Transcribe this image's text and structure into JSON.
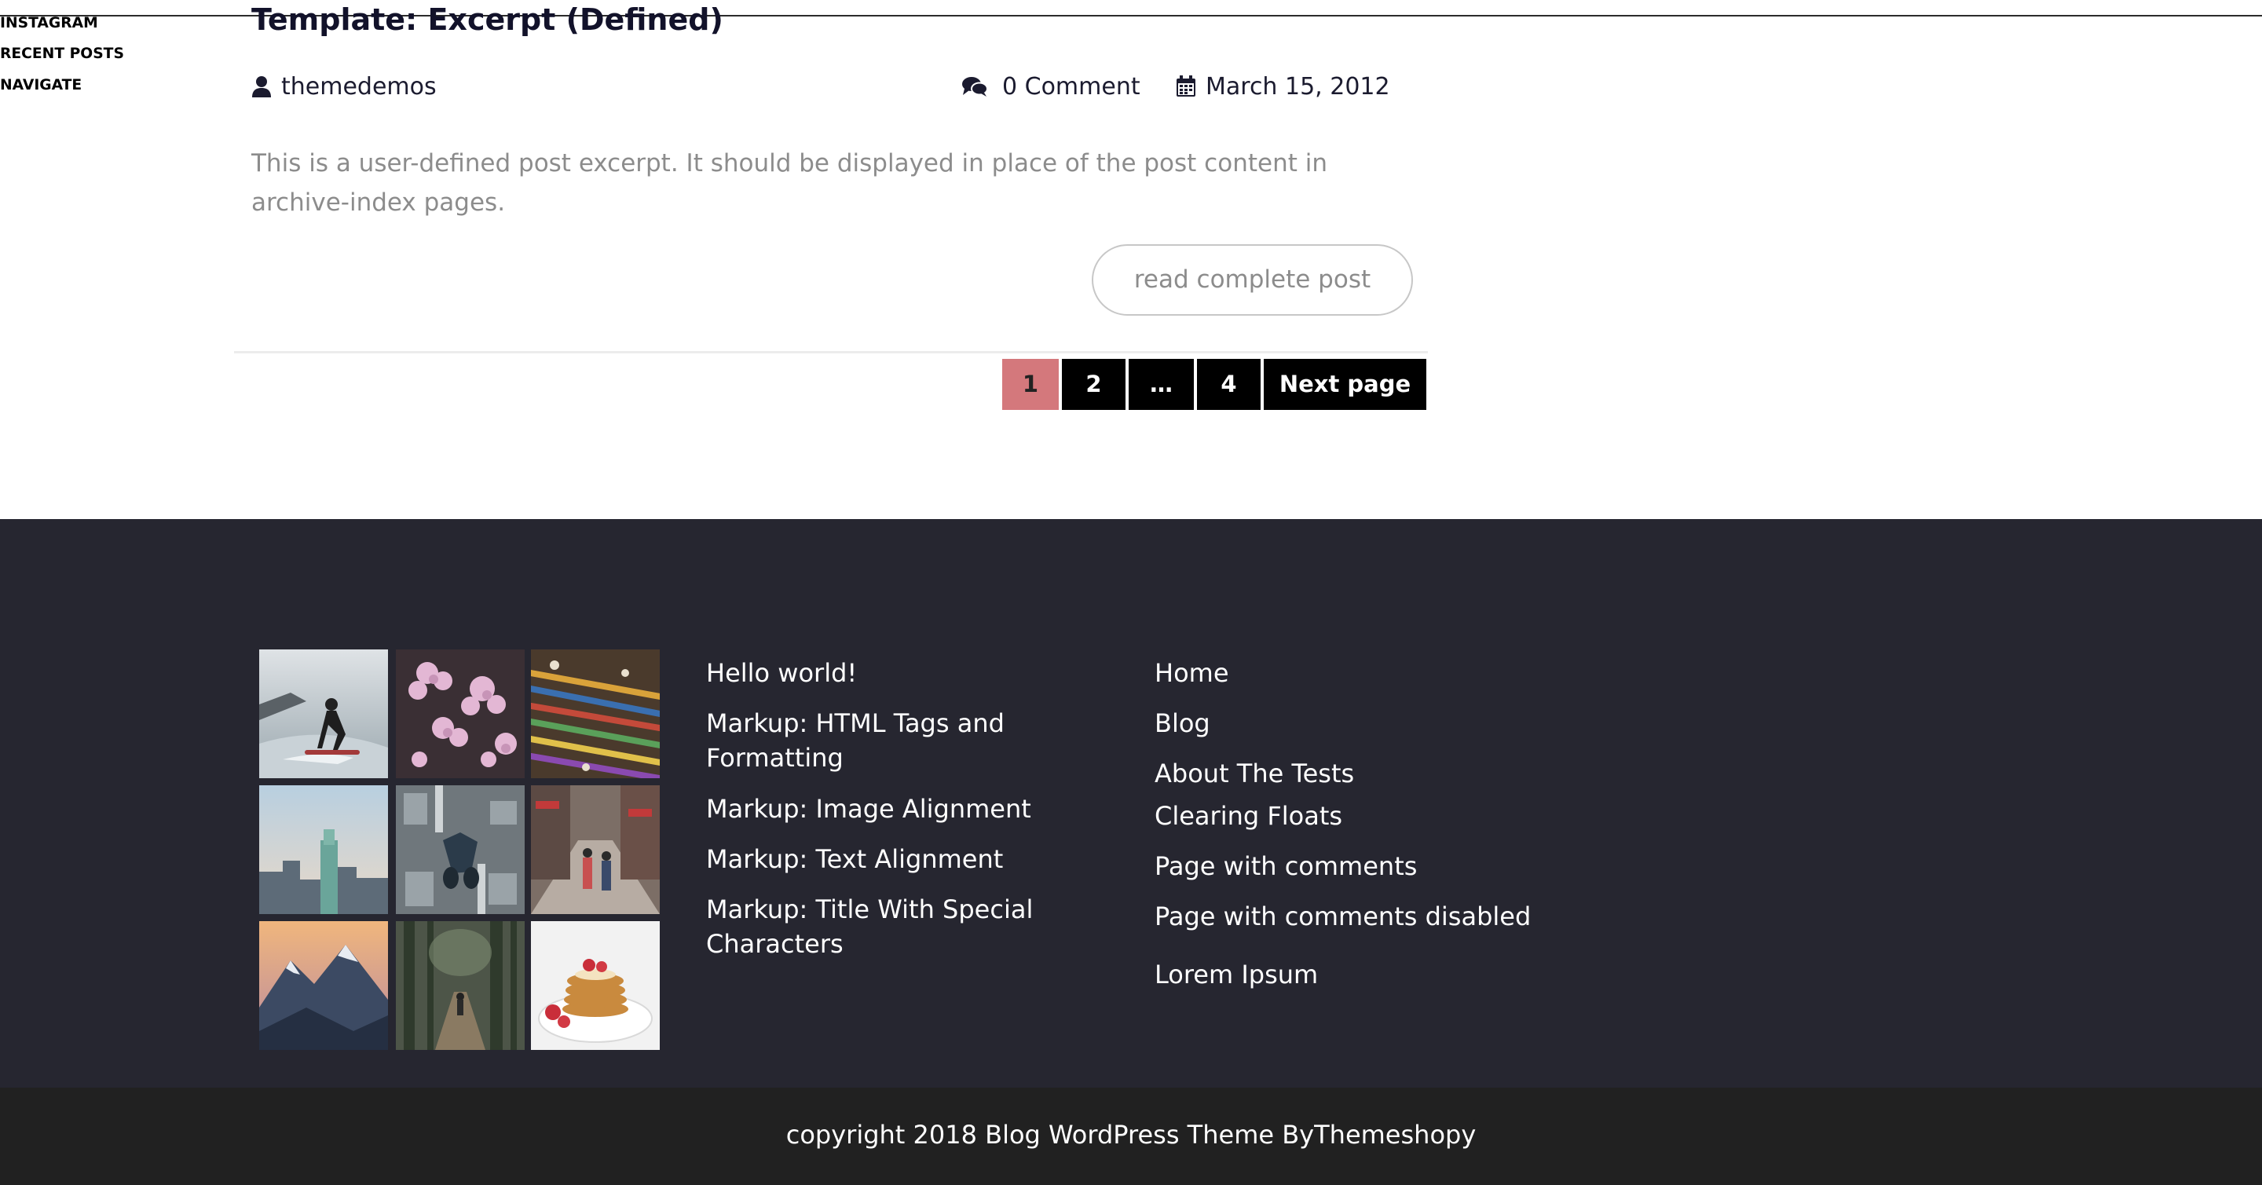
{
  "post": {
    "title": "Template: Excerpt (Defined)",
    "author": "themedemos",
    "comments": "0 Comment",
    "date": "March 15, 2012",
    "excerpt": "This is a user-defined post excerpt. It should be displayed in place of the post content in archive-index pages.",
    "read_more": "read complete post"
  },
  "pagination": {
    "pages": [
      "1",
      "2",
      "…",
      "4"
    ],
    "current": "1",
    "next": "Next page",
    "current_color": "#d4787c"
  },
  "footer": {
    "instagram": {
      "title": "INSTAGRAM",
      "images": [
        "surfer",
        "pink-flowers",
        "paint-brushes",
        "city-skyline",
        "city-from-above",
        "street-market",
        "mountains",
        "forest-hiker",
        "pancakes"
      ]
    },
    "recent_posts": {
      "title": "RECENT POSTS",
      "items": [
        "Hello world!",
        "Markup: HTML Tags and Formatting",
        "Markup: Image Alignment",
        "Markup: Text Alignment",
        "Markup: Title With Special Characters"
      ]
    },
    "navigate": {
      "title": "NAVIGATE",
      "items": [
        "Home",
        "Blog",
        "About The Tests",
        "Clearing Floats",
        "Page with comments",
        "Page with comments disabled",
        "Lorem Ipsum"
      ]
    },
    "copyright": "copyright 2018 Blog WordPress Theme ByThemeshopy",
    "colors": {
      "footer_bg": "#262630",
      "bottom_bg": "#212121"
    }
  }
}
